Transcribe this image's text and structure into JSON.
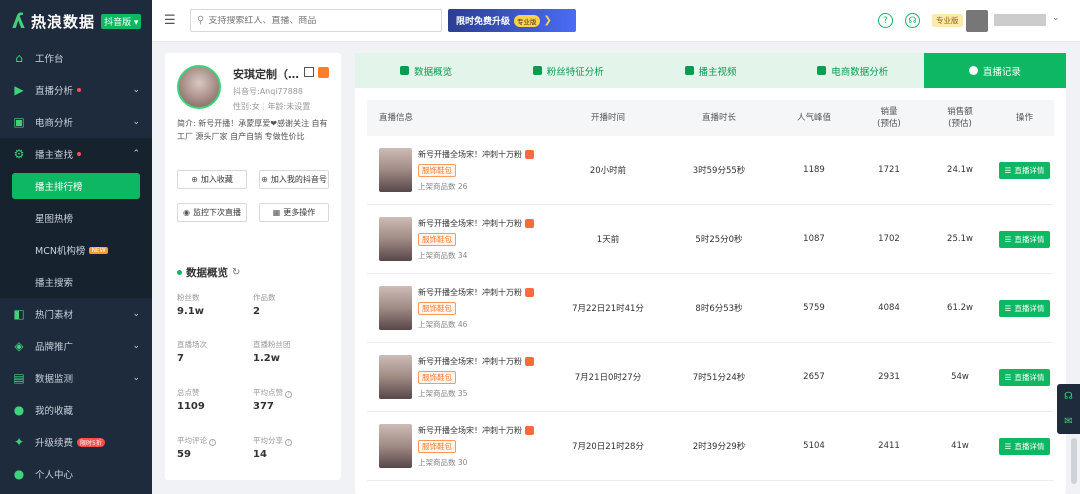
{
  "app": {
    "logo_text": "热浪数据",
    "logo_badge": "抖音版 ▾"
  },
  "sidebar": {
    "items": [
      {
        "label": "工作台",
        "icon": "home-icon"
      },
      {
        "label": "直播分析",
        "icon": "live-icon",
        "dot": true
      },
      {
        "label": "电商分析",
        "icon": "cart-icon"
      },
      {
        "label": "播主查找",
        "icon": "search-person-icon",
        "dot": true,
        "open": true
      },
      {
        "label": "热门素材",
        "icon": "fire-icon"
      },
      {
        "label": "品牌推广",
        "icon": "brand-icon"
      },
      {
        "label": "数据监测",
        "icon": "monitor-icon"
      },
      {
        "label": "我的收藏",
        "icon": "star-icon"
      },
      {
        "label": "升级续费",
        "icon": "upgrade-icon",
        "badge": "限时5折"
      },
      {
        "label": "个人中心",
        "icon": "user-icon"
      }
    ],
    "sub_items": [
      {
        "label": "播主排行榜",
        "active": true
      },
      {
        "label": "星图热榜"
      },
      {
        "label": "MCN机构榜",
        "badge": "NEW"
      },
      {
        "label": "播主搜索"
      }
    ]
  },
  "topbar": {
    "search_placeholder": "支持搜索红人、直播、商品",
    "promo_text": "限时免费升级",
    "promo_tag": "专业版",
    "plan_badge": "专业版"
  },
  "profile": {
    "name": "安琪定制（…",
    "account": "抖音号:Anqi77888",
    "gender": "性别:女",
    "age": "年龄:未设置",
    "intro": "简介: 新号开播！承蒙厚爱❤感谢关注 自有工厂 源头厂家 自产自销 专做性价比",
    "actions": {
      "favorite": "加入收藏",
      "add_to_mine": "加入我的抖音号",
      "monitor": "监控下次直播",
      "more": "更多操作"
    },
    "overview_title": "数据概览",
    "stats": [
      {
        "label": "粉丝数",
        "value": "9.1w"
      },
      {
        "label": "作品数",
        "value": "2"
      },
      {
        "label": "直播场次",
        "value": "7"
      },
      {
        "label": "直播粉丝团",
        "value": "1.2w"
      },
      {
        "label": "总点赞",
        "value": "1109"
      },
      {
        "label": "平均点赞",
        "value": "377",
        "help": true
      },
      {
        "label": "平均评论",
        "value": "59",
        "help": true
      },
      {
        "label": "平均分享",
        "value": "14",
        "help": true
      }
    ]
  },
  "tabs": [
    {
      "label": "数据概览"
    },
    {
      "label": "粉丝特征分析"
    },
    {
      "label": "播主视频"
    },
    {
      "label": "电商数据分析"
    },
    {
      "label": "直播记录",
      "active": true
    }
  ],
  "table": {
    "headers": {
      "info": "直播信息",
      "start": "开播时间",
      "duration": "直播时长",
      "peak": "人气峰值",
      "sales_1": "销量",
      "sales_2": "(预估)",
      "revenue_1": "销售额",
      "revenue_2": "(预估)",
      "action": "操作"
    },
    "rows": [
      {
        "title": "新号开播全场宋！冲刺十万粉",
        "tag": "服饰鞋包",
        "goods": "上架商品数 26",
        "start": "20小时前",
        "duration": "3时59分55秒",
        "peak": "1189",
        "sales": "1721",
        "revenue": "24.1w",
        "action": "直播详情"
      },
      {
        "title": "新号开播全场宋！冲刺十万粉",
        "tag": "服饰鞋包",
        "goods": "上架商品数 34",
        "start": "1天前",
        "duration": "5时25分0秒",
        "peak": "1087",
        "sales": "1702",
        "revenue": "25.1w",
        "action": "直播详情"
      },
      {
        "title": "新号开播全场宋！冲刺十万粉",
        "tag": "服饰鞋包",
        "goods": "上架商品数 46",
        "start": "7月22日21时41分",
        "duration": "8时6分53秒",
        "peak": "5759",
        "sales": "4084",
        "revenue": "61.2w",
        "action": "直播详情"
      },
      {
        "title": "新号开播全场宋！冲刺十万粉",
        "tag": "服饰鞋包",
        "goods": "上架商品数 35",
        "start": "7月21日0时27分",
        "duration": "7时51分24秒",
        "peak": "2657",
        "sales": "2931",
        "revenue": "54w",
        "action": "直播详情"
      },
      {
        "title": "新号开播全场宋！冲刺十万粉",
        "tag": "服饰鞋包",
        "goods": "上架商品数 30",
        "start": "7月20日21时28分",
        "duration": "2时39分29秒",
        "peak": "5104",
        "sales": "2411",
        "revenue": "41w",
        "action": "直播详情"
      }
    ]
  },
  "colors": {
    "brand": "#0eb863",
    "sidebar_bg": "#1e2b3d",
    "tab_bg": "#e3f5ea",
    "tag_orange": "#ff7a2e"
  }
}
